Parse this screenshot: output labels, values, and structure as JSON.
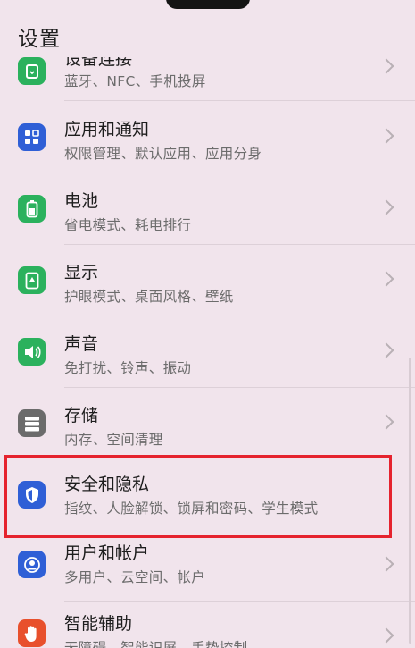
{
  "header": {
    "title": "设置"
  },
  "items": [
    {
      "title": "设备连接",
      "subtitle": "蓝牙、NFC、手机投屏",
      "icon": "device-connection-icon",
      "color": "#2bb15d"
    },
    {
      "title": "应用和通知",
      "subtitle": "权限管理、默认应用、应用分身",
      "icon": "apps-grid-icon",
      "color": "#2f5fd6"
    },
    {
      "title": "电池",
      "subtitle": "省电模式、耗电排行",
      "icon": "battery-icon",
      "color": "#2bb15d"
    },
    {
      "title": "显示",
      "subtitle": "护眼模式、桌面风格、壁纸",
      "icon": "display-icon",
      "color": "#2bb15d"
    },
    {
      "title": "声音",
      "subtitle": "免打扰、铃声、振动",
      "icon": "speaker-icon",
      "color": "#2bb15d"
    },
    {
      "title": "存储",
      "subtitle": "内存、空间清理",
      "icon": "storage-icon",
      "color": "#6b6b6b"
    },
    {
      "title": "安全和隐私",
      "subtitle": "指纹、人脸解锁、锁屏和密码、学生模式",
      "icon": "shield-icon",
      "color": "#2f5fd6"
    },
    {
      "title": "用户和帐户",
      "subtitle": "多用户、云空间、帐户",
      "icon": "user-icon",
      "color": "#2f5fd6"
    },
    {
      "title": "智能辅助",
      "subtitle": "无障碍、智能识屏、手势控制",
      "icon": "hand-icon",
      "color": "#e8502c"
    }
  ],
  "highlight": {
    "color": "#e5232e",
    "target": "安全和隐私"
  }
}
